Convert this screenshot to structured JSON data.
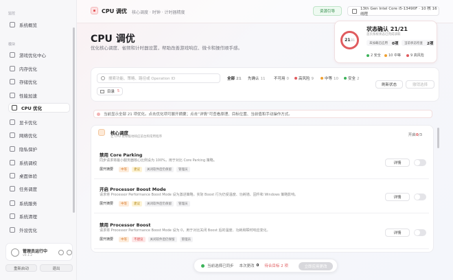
{
  "sidebar": {
    "group1": "监控",
    "group2": "模块",
    "items": [
      {
        "label": "系统概览"
      },
      {
        "label": "游戏优化中心"
      },
      {
        "label": "内存优化"
      },
      {
        "label": "存储优化"
      },
      {
        "label": "性能加速"
      },
      {
        "label": "CPU 优化"
      },
      {
        "label": "显卡优化"
      },
      {
        "label": "网络优化"
      },
      {
        "label": "隐私保护"
      },
      {
        "label": "系统调校"
      },
      {
        "label": "桌面体验"
      },
      {
        "label": "任务调度"
      },
      {
        "label": "系统服务"
      },
      {
        "label": "系统清理"
      },
      {
        "label": "外设优化"
      }
    ],
    "user": {
      "name": "管理员运行中",
      "version": "v0.1.2"
    },
    "restart_label": "重新启动",
    "exit_label": "退出"
  },
  "header": {
    "title": "CPU 调优",
    "subtitle": "核心调度 · 时钟 · 计时器精度",
    "resource_label": "资源引导",
    "cpu_name": "13th Gen Intel Core i5-13490F · 10 核 16 线程"
  },
  "hero": {
    "title": "CPU 调优",
    "description": "优化核心调度、省频和计时器设置，帮助改善游戏响应、微卡和操作顺手感。"
  },
  "status": {
    "title": "状态确认 21/21",
    "subtitle": "首页系统状态已完成读取",
    "ring_value": "21",
    "ring_total": "/21",
    "row1_label": "未加载已应用",
    "row1_value": "0项",
    "row2_label": "当前状态检查",
    "row2_value": "2项",
    "safe": "2 安全",
    "mid": "10 中等",
    "high": "9 高风险"
  },
  "filter": {
    "search_placeholder": "搜索功能、策略、路径或 Operation ID",
    "chips": [
      {
        "label": "全部",
        "count": "21"
      },
      {
        "label": "先确认",
        "count": "11"
      },
      {
        "label": "不可用",
        "count": "0"
      },
      {
        "label": "高风险",
        "count": "9"
      },
      {
        "label": "中等",
        "count": "10"
      },
      {
        "label": "安全",
        "count": "2"
      }
    ],
    "refresh_label": "刷新状态",
    "clear_label": "撤销选择",
    "catalog_label": "目录",
    "catalog_count": "5"
  },
  "info_text": "当前显示全部 21 项优化。点击优化项可展开摘要；点击“详情”可查看原理、目标位置、当前值和手动操作方式。",
  "group": {
    "title": "核心调度",
    "subtitle": "让 CPU 更积极地响应前台和常用程序",
    "count_prefix": "开启",
    "count_on": "0",
    "count_rest": "/3"
  },
  "tweaks": [
    {
      "title": "禁用 Core Parking",
      "desc": "同步请求将最小服务器核心比例设为 100%，用于对比 Core Parking 策略。",
      "expand": "展开摘要",
      "level": "中等",
      "risk": "建议",
      "tag1": "关闭软件后仍保留",
      "tag2": "管理员",
      "detail": "详情"
    },
    {
      "title": "开启 Processor Boost Mode",
      "desc": "请求将 Processor Performance Boost Mode 设为激进策略，实际 Boost 行为仍受温度、功耗墙、固件和 Windows 策略影响。",
      "expand": "展开摘要",
      "level": "中等",
      "risk": "建议",
      "tag1": "关闭软件后仍保留",
      "tag2": "管理员",
      "detail": "详情"
    },
    {
      "title": "禁用 Processor Boost",
      "desc": "请求将 Processor Performance Boost Mode 设为 0，用于对比关闭 Boost 后的温度、功耗和瞬时响应变化。",
      "expand": "展开摘要",
      "level": "中等",
      "risk": "不建议",
      "tag1": "关闭软件后仍保留",
      "tag2": "管理员",
      "detail": "详情"
    }
  ],
  "bottom": {
    "sync_label": "当前选择已同步",
    "changes_label": "本次更改",
    "changes_count": "0",
    "pending_label": "待合目标 2 项",
    "apply_label": "立即应用更改"
  },
  "colors": {
    "accent": "#e05b5e",
    "ok": "#3cb35a"
  }
}
